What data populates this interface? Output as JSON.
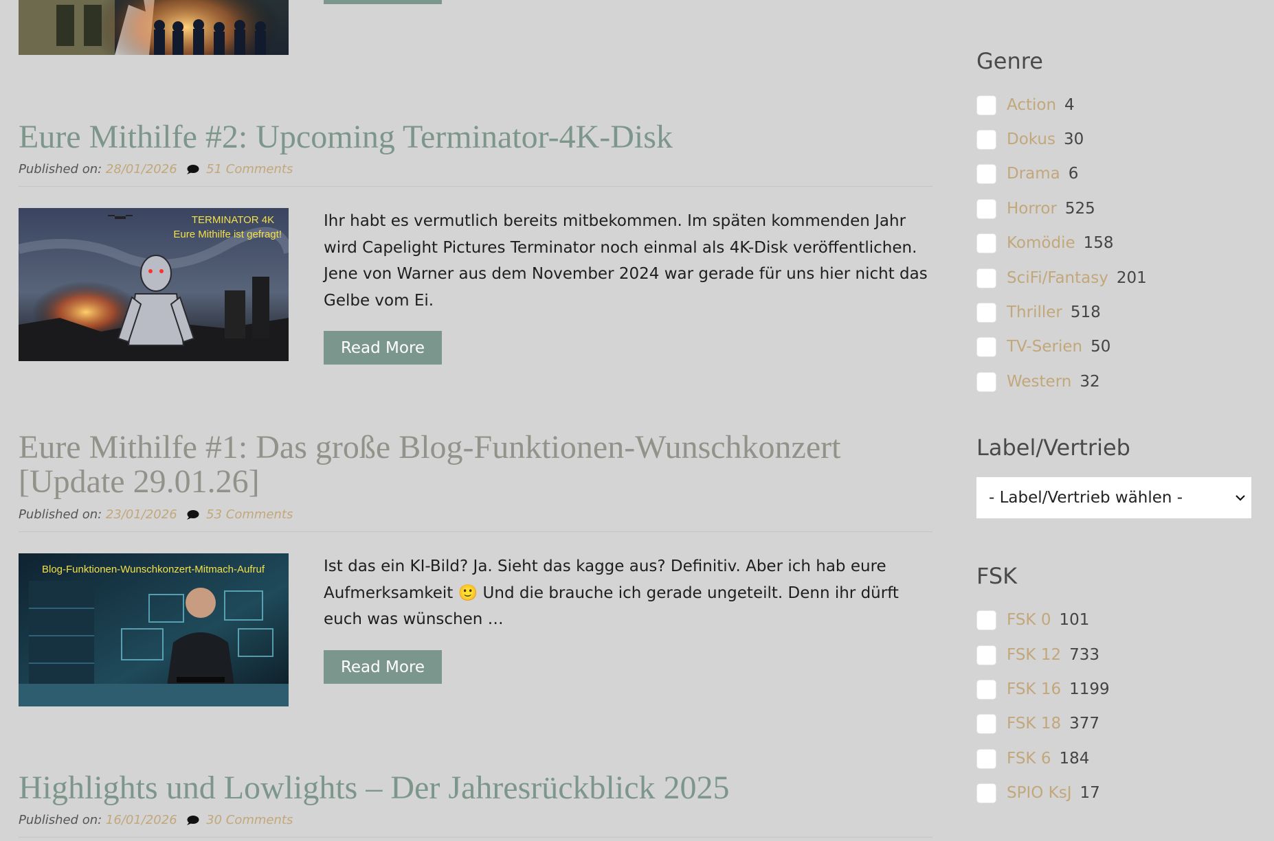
{
  "posts": [
    {
      "title": "",
      "read_more": ""
    },
    {
      "title": "Eure Mithilfe #2: Upcoming Terminator-4K-Disk",
      "published_label": "Published on:",
      "date": "28/01/2026",
      "comments": "51 Comments",
      "thumb_caption_1": "TERMINATOR 4K",
      "thumb_caption_2": "Eure Mithilfe ist gefragt!",
      "excerpt": "Ihr habt es vermutlich bereits mitbekommen. Im späten kommenden Jahr wird Capelight Pictures Terminator noch einmal als 4K-Disk veröffentlichen. Jene von Warner aus dem November 2024 war gerade für uns hier nicht das Gelbe vom Ei.",
      "read_more": "Read More"
    },
    {
      "title": "Eure Mithilfe #1: Das große Blog-Funktionen-Wunschkonzert [Update 29.01.26]",
      "published_label": "Published on:",
      "date": "23/01/2026",
      "comments": "53 Comments",
      "thumb_caption": "Blog-Funktionen-Wunschkonzert-Mitmach-Aufruf",
      "excerpt_a": "Ist das ein KI-Bild? Ja. Sieht das kagge aus? Definitiv. Aber ich hab eure Aufmerksamkeit",
      "excerpt_emoji": "🙂",
      "excerpt_b": " Und die brauche ich gerade ungeteilt. Denn ihr dürft euch was wünschen …",
      "read_more": "Read More"
    },
    {
      "title": "Highlights und Lowlights – Der Jahresrückblick 2025",
      "published_label": "Published on:",
      "date": "16/01/2026",
      "comments": "30 Comments"
    }
  ],
  "sidebar": {
    "genre": {
      "title": "Genre",
      "items": [
        {
          "label": "Action",
          "count": "4"
        },
        {
          "label": "Dokus",
          "count": "30"
        },
        {
          "label": "Drama",
          "count": "6"
        },
        {
          "label": "Horror",
          "count": "525"
        },
        {
          "label": "Komödie",
          "count": "158"
        },
        {
          "label": "SciFi/Fantasy",
          "count": "201"
        },
        {
          "label": "Thriller",
          "count": "518"
        },
        {
          "label": "TV-Serien",
          "count": "50"
        },
        {
          "label": "Western",
          "count": "32"
        }
      ]
    },
    "label": {
      "title": "Label/Vertrieb",
      "select_value": "- Label/Vertrieb wählen -"
    },
    "fsk": {
      "title": "FSK",
      "items": [
        {
          "label": "FSK 0",
          "count": "101"
        },
        {
          "label": "FSK 12",
          "count": "733"
        },
        {
          "label": "FSK 16",
          "count": "1199"
        },
        {
          "label": "FSK 18",
          "count": "377"
        },
        {
          "label": "FSK 6",
          "count": "184"
        },
        {
          "label": "SPIO KsJ",
          "count": "17"
        }
      ]
    }
  },
  "colors": {
    "background": "#d4d4d4",
    "title_green": "#7d968b",
    "link_gold": "#c2a77a",
    "button": "#7b968d"
  },
  "icons": [
    "comment-bubble-icon",
    "chevron-down-icon"
  ]
}
